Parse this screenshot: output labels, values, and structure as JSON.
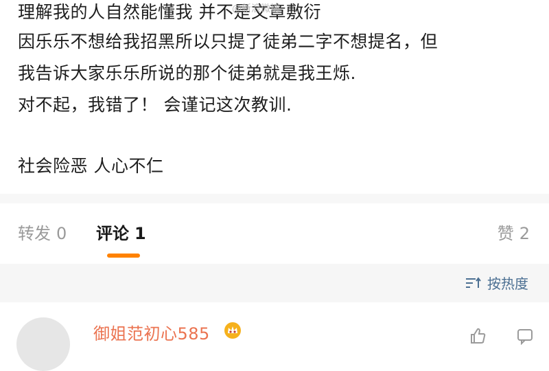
{
  "post": {
    "lines": [
      "理解我的人自然能懂我   并不是文章敷衍",
      "因乐乐不想给我招黑所以只提了徒弟二字不想提名，但",
      "我告诉大家乐乐所说的那个徒弟就是我王烁.",
      "对不起，我错了！  会谨记这次教训.",
      "社会险恶   人心不仁"
    ],
    "watermark": "@新浪微博"
  },
  "tabs": {
    "repost": {
      "label": "转发",
      "count": "0"
    },
    "comment": {
      "label": "评论",
      "count": "1"
    },
    "like": {
      "label": "赞",
      "count": "2"
    }
  },
  "sort": {
    "label": "按热度",
    "icon": "sort-icon"
  },
  "comment": {
    "username": "御姐范初心585",
    "badge_icon": "crown-badge-icon"
  },
  "colors": {
    "accent_orange": "#ff8200",
    "username_orange": "#eb7350",
    "link_blue": "#4b6f92",
    "muted_gray": "#9a9a9a"
  }
}
